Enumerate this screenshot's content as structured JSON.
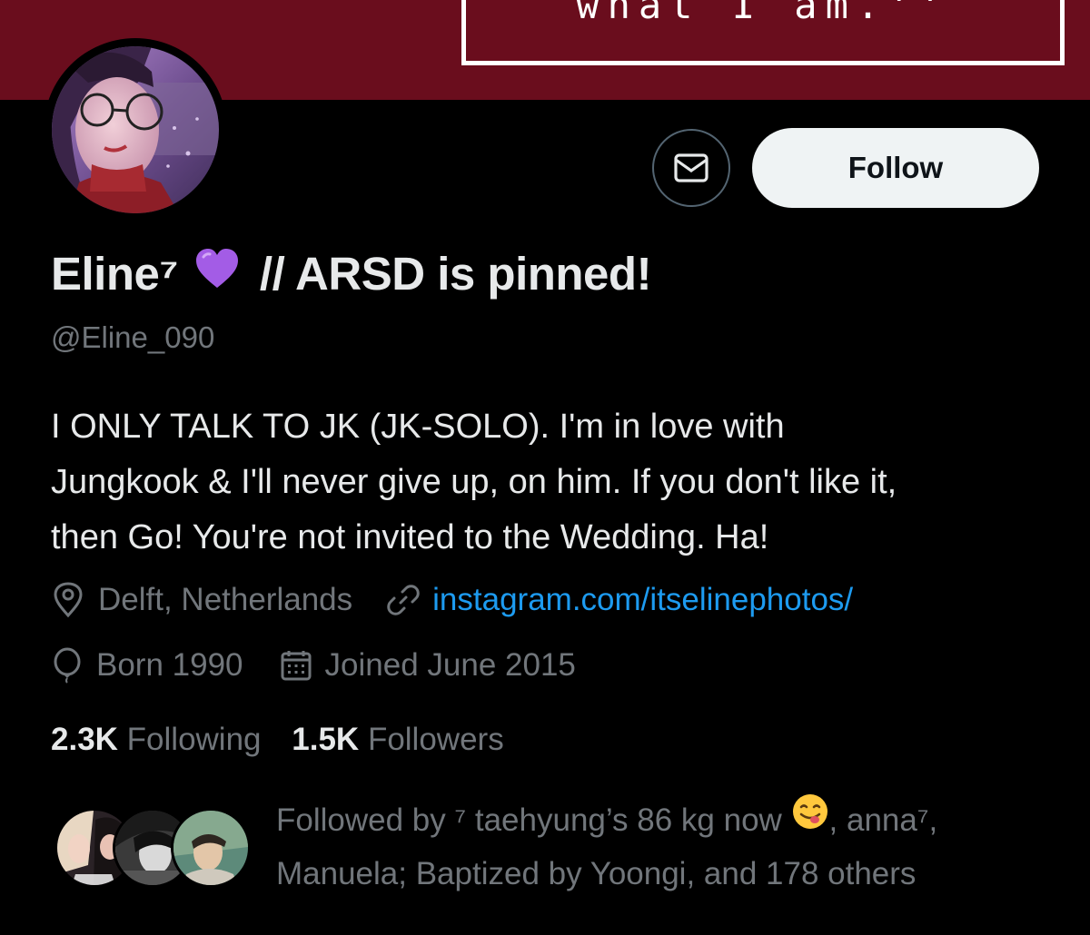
{
  "banner": {
    "text": "what I am.''",
    "background": "#6a0d1d"
  },
  "profile": {
    "avatar_icon": "profile-photo",
    "display_name_part1": "Eline⁷",
    "display_name_emoji": "purple-heart-icon",
    "display_name_part2": "// ARSD is pinned!",
    "handle": "@Eline_090",
    "bio_lines": [
      "I ONLY TALK TO JK (JK-SOLO). I'm in love with",
      "Jungkook & I'll never give up, on him. If you don't like it,",
      "then Go! You're not invited to the Wedding. Ha!"
    ],
    "location": "Delft, Netherlands",
    "website": "instagram.com/itselinephotos/",
    "born": "Born 1990",
    "joined": "Joined June 2015"
  },
  "actions": {
    "message_icon": "envelope-icon",
    "follow_label": "Follow"
  },
  "stats": {
    "following_count": "2.3K",
    "following_label": "Following",
    "followers_count": "1.5K",
    "followers_label": "Followers"
  },
  "followed_by": {
    "prefix": "Followed by ⁷ taehyung’s 86 kg now",
    "emoji": "face-savoring-food-icon",
    "after_emoji": ", anna⁷,",
    "line2": "Manuela; Baptized by Yoongi, and 178 others"
  },
  "colors": {
    "background": "#000000",
    "primary_text": "#e7e9ea",
    "secondary_text": "#71767b",
    "link": "#1d9bf0",
    "follow_button": "#eff3f4"
  }
}
